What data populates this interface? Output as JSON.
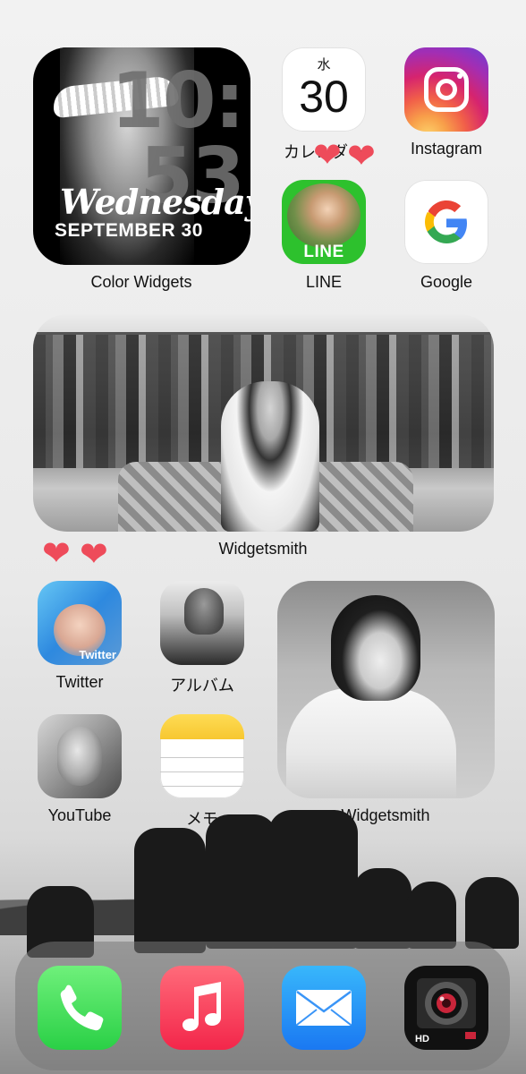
{
  "widgets": {
    "color_widget": {
      "clock_lines": [
        "10:",
        "53"
      ],
      "weekday": "Wednesday",
      "date": "SEPTEMBER 30",
      "label": "Color Widgets"
    },
    "widgetsmith_wide": {
      "label": "Widgetsmith"
    },
    "widgetsmith_square": {
      "label": "Widgetsmith"
    }
  },
  "apps": {
    "calendar": {
      "weekday": "水",
      "day": "30",
      "label": "カレンダー"
    },
    "instagram": {
      "label": "Instagram"
    },
    "line": {
      "badge": "LINE",
      "label": "LINE"
    },
    "google": {
      "label": "Google"
    },
    "twitter": {
      "badge": "Twitter",
      "label": "Twitter"
    },
    "album": {
      "label": "アルバム"
    },
    "youtube": {
      "label": "YouTube"
    },
    "memo": {
      "label": "メモ"
    }
  },
  "dock": {
    "apps": [
      "phone",
      "music",
      "mail",
      "camera"
    ],
    "camera_badge": "HD"
  },
  "decorations": {
    "heart_glyph": "❤"
  },
  "colors": {
    "heart": "#ee4b5a",
    "line_green": "#2dc12d",
    "phone_green": "#2ad046",
    "music_red": "#f3264a",
    "mail_blue": "#1a78f2"
  }
}
